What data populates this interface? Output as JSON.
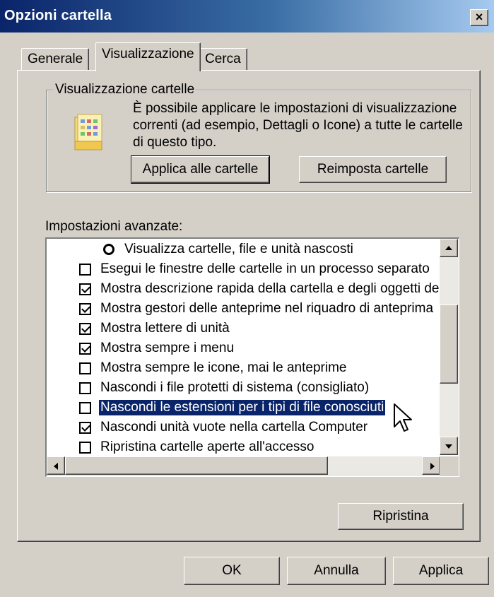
{
  "window": {
    "title": "Opzioni cartella",
    "close_label": "×"
  },
  "tabs": [
    {
      "label": "Generale",
      "active": false
    },
    {
      "label": "Visualizzazione",
      "active": true
    },
    {
      "label": "Cerca",
      "active": false
    }
  ],
  "folder_view": {
    "legend": "Visualizzazione cartelle",
    "description": "È possibile applicare le impostazioni di visualizzazione correnti (ad esempio, Dettagli o Icone) a tutte le cartelle di questo tipo.",
    "apply_button": "Applica alle cartelle",
    "reset_button": "Reimposta cartelle",
    "icon": "folder-icon"
  },
  "advanced": {
    "label": "Impostazioni avanzate:",
    "items": [
      {
        "type": "radio",
        "checked": false,
        "label": "Visualizza cartelle, file e unità nascosti"
      },
      {
        "type": "checkbox",
        "checked": false,
        "label": "Esegui le finestre delle cartelle in un processo separato"
      },
      {
        "type": "checkbox",
        "checked": true,
        "label": "Mostra descrizione rapida della cartella e degli oggetti de"
      },
      {
        "type": "checkbox",
        "checked": true,
        "label": "Mostra gestori delle anteprime nel riquadro di anteprima"
      },
      {
        "type": "checkbox",
        "checked": true,
        "label": "Mostra lettere di unità"
      },
      {
        "type": "checkbox",
        "checked": true,
        "label": "Mostra sempre i menu"
      },
      {
        "type": "checkbox",
        "checked": false,
        "label": "Mostra sempre le icone, mai le anteprime"
      },
      {
        "type": "checkbox",
        "checked": false,
        "label": "Nascondi i file protetti di sistema (consigliato)"
      },
      {
        "type": "checkbox",
        "checked": false,
        "label": "Nascondi le estensioni per i tipi di file conosciuti",
        "selected": true
      },
      {
        "type": "checkbox",
        "checked": true,
        "label": "Nascondi unità vuote nella cartella Computer"
      },
      {
        "type": "checkbox",
        "checked": false,
        "label": "Ripristina cartelle aperte all'accesso"
      }
    ],
    "restore_button": "Ripristina"
  },
  "footer": {
    "ok": "OK",
    "cancel": "Annulla",
    "apply": "Applica"
  },
  "colors": {
    "title_start": "#0a246a",
    "title_end": "#a6caf0",
    "selection": "#0a246a",
    "face": "#d4d0c8"
  }
}
